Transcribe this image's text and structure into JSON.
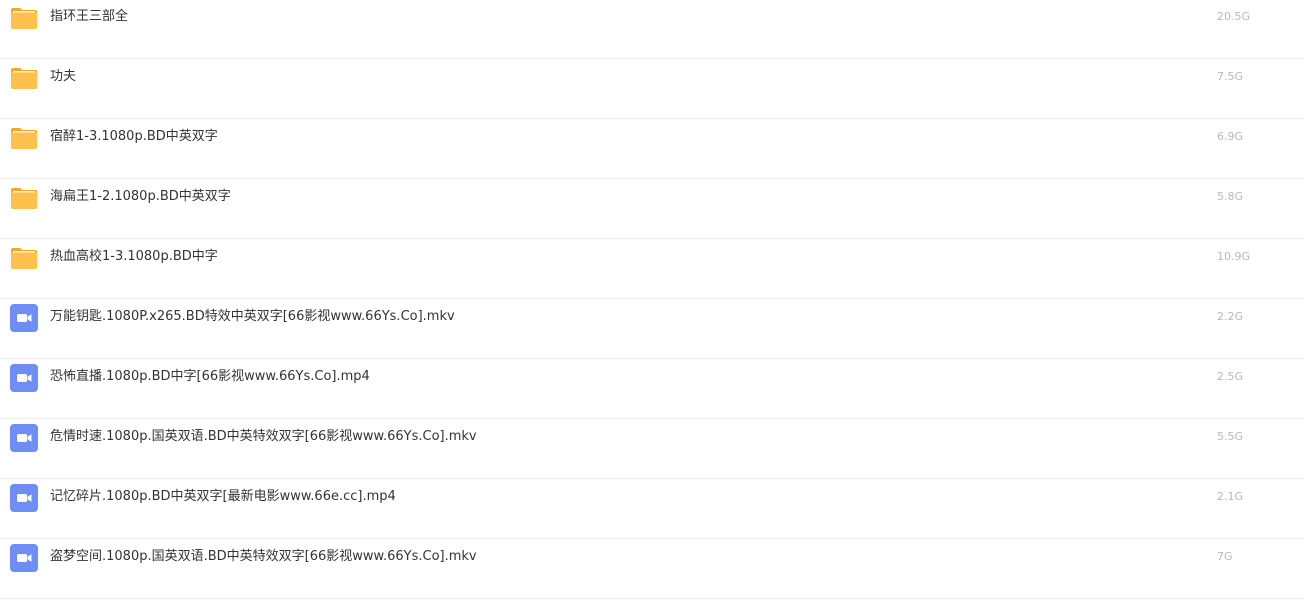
{
  "colors": {
    "folder": "#ffc14d",
    "folder_tab": "#f5a623",
    "video": "#6f8ef5",
    "name_text": "#333333",
    "size_text": "#b5b9c0",
    "divider": "#ebedf0"
  },
  "files": [
    {
      "type": "folder",
      "icon": "folder-icon",
      "name": "指环王三部全",
      "size": "20.5G"
    },
    {
      "type": "folder",
      "icon": "folder-icon",
      "name": "功夫",
      "size": "7.5G"
    },
    {
      "type": "folder",
      "icon": "folder-icon",
      "name": "宿醉1-3.1080p.BD中英双字",
      "size": "6.9G"
    },
    {
      "type": "folder",
      "icon": "folder-icon",
      "name": "海扁王1-2.1080p.BD中英双字",
      "size": "5.8G"
    },
    {
      "type": "folder",
      "icon": "folder-icon",
      "name": "热血高校1-3.1080p.BD中字",
      "size": "10.9G"
    },
    {
      "type": "video",
      "icon": "video-icon",
      "name": "万能钥匙.1080P.x265.BD特效中英双字[66影视www.66Ys.Co].mkv",
      "size": "2.2G"
    },
    {
      "type": "video",
      "icon": "video-icon",
      "name": "恐怖直播.1080p.BD中字[66影视www.66Ys.Co].mp4",
      "size": "2.5G"
    },
    {
      "type": "video",
      "icon": "video-icon",
      "name": "危情时速.1080p.国英双语.BD中英特效双字[66影视www.66Ys.Co].mkv",
      "size": "5.5G"
    },
    {
      "type": "video",
      "icon": "video-icon",
      "name": "记忆碎片.1080p.BD中英双字[最新电影www.66e.cc].mp4",
      "size": "2.1G"
    },
    {
      "type": "video",
      "icon": "video-icon",
      "name": "盗梦空间.1080p.国英双语.BD中英特效双字[66影视www.66Ys.Co].mkv",
      "size": "7G"
    }
  ]
}
